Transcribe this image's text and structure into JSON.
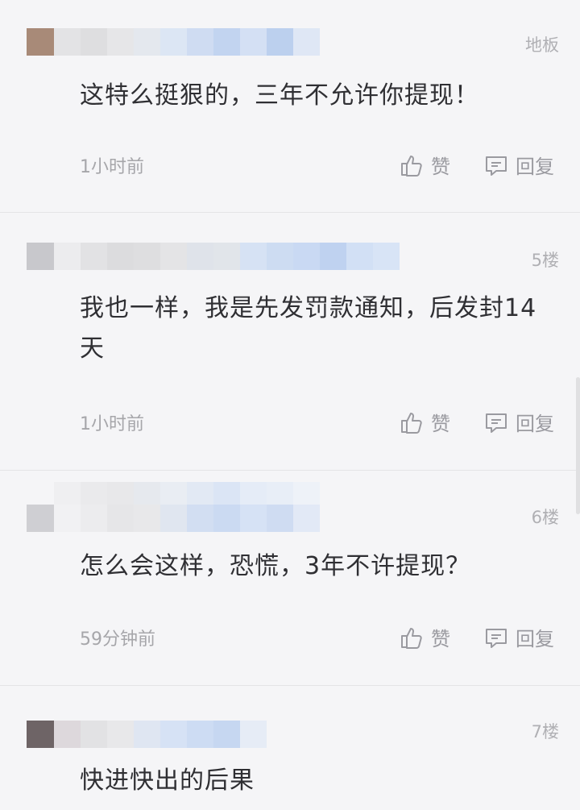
{
  "comments": [
    {
      "floor": "地板",
      "text": "这特么挺狠的，三年不允许你提现！",
      "time": "1小时前",
      "like_label": "赞",
      "reply_label": "回复"
    },
    {
      "floor": "5楼",
      "text": "我也一样，我是先发罚款通知，后发封14天",
      "time": "1小时前",
      "like_label": "赞",
      "reply_label": "回复"
    },
    {
      "floor": "6楼",
      "text": "怎么会这样，恐慌，3年不许提现？",
      "time": "59分钟前",
      "like_label": "赞",
      "reply_label": "回复"
    },
    {
      "floor": "7楼",
      "text": "快进快出的后果"
    }
  ],
  "icons": {
    "like": "thumbs-up-icon",
    "reply": "comment-bubble-icon"
  },
  "colors": {
    "background": "#f5f5f7",
    "text": "#2f2f33",
    "meta": "#a6a6aa",
    "blur_blue": "#c9d9f3"
  }
}
